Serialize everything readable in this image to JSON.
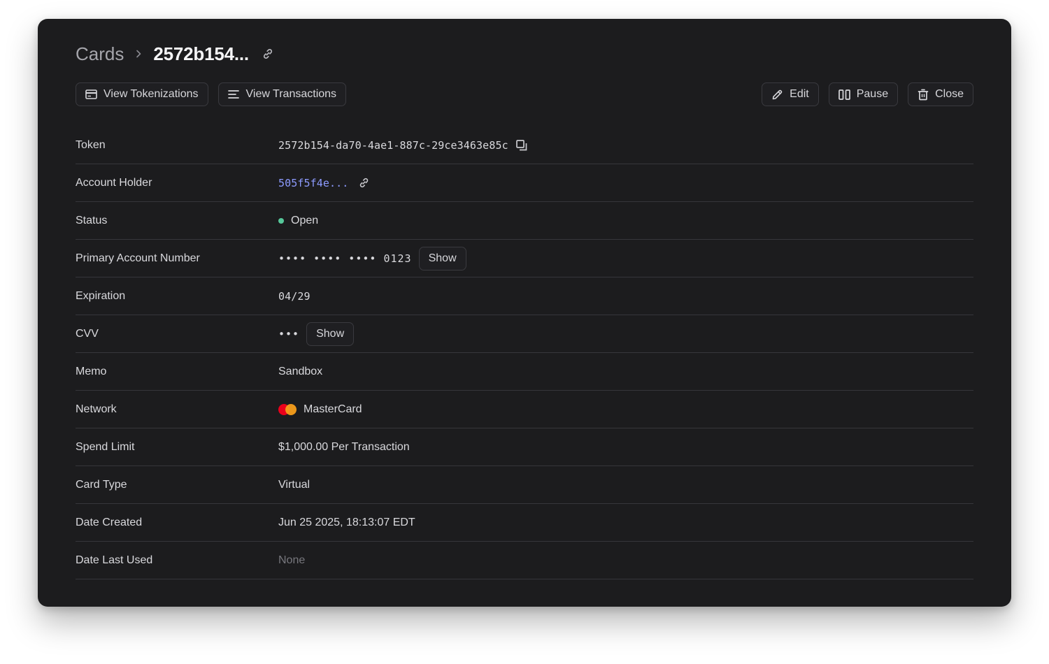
{
  "breadcrumb": {
    "root": "Cards",
    "current": "2572b154..."
  },
  "toolbar": {
    "left": [
      {
        "label": "View Tokenizations",
        "icon": "card-icon"
      },
      {
        "label": "View Transactions",
        "icon": "list-icon"
      }
    ],
    "right": [
      {
        "label": "Edit",
        "icon": "pencil-icon"
      },
      {
        "label": "Pause",
        "icon": "pause-icon"
      },
      {
        "label": "Close",
        "icon": "trash-icon"
      }
    ]
  },
  "fields": {
    "token": {
      "label": "Token",
      "value": "2572b154-da70-4ae1-887c-29ce3463e85c"
    },
    "account_holder": {
      "label": "Account Holder",
      "value": "505f5f4e..."
    },
    "status": {
      "label": "Status",
      "value": "Open",
      "color": "#56c79a"
    },
    "pan": {
      "label": "Primary Account Number",
      "value": "•••• •••• •••• 0123",
      "action": "Show"
    },
    "expiration": {
      "label": "Expiration",
      "value": "04/29"
    },
    "cvv": {
      "label": "CVV",
      "value": "•••",
      "action": "Show"
    },
    "memo": {
      "label": "Memo",
      "value": "Sandbox"
    },
    "network": {
      "label": "Network",
      "value": "MasterCard"
    },
    "spend_limit": {
      "label": "Spend Limit",
      "value": "$1,000.00 Per Transaction"
    },
    "card_type": {
      "label": "Card Type",
      "value": "Virtual"
    },
    "date_created": {
      "label": "Date Created",
      "value": "Jun 25 2025, 18:13:07 EDT"
    },
    "date_last_used": {
      "label": "Date Last Used",
      "value": "None"
    }
  },
  "colors": {
    "panel": "#1c1c1e",
    "accent": "#8d9bff",
    "status_open": "#56c79a",
    "border": "#36363b"
  }
}
